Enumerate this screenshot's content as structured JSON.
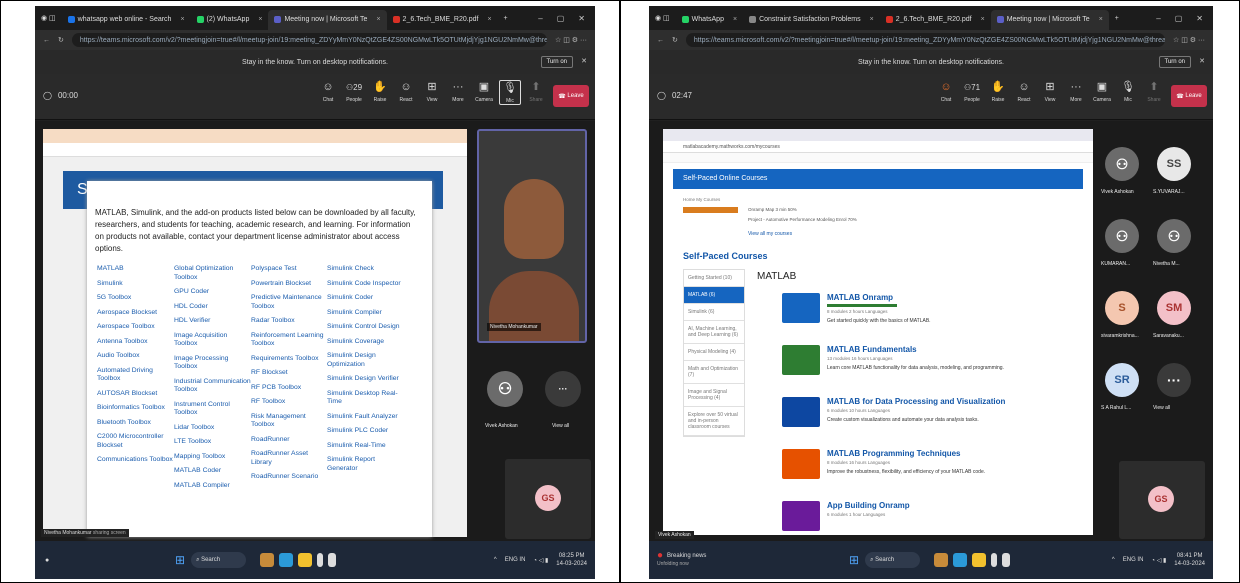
{
  "left": {
    "tabs": [
      {
        "label": "whatsapp web online - Search",
        "color": "#1a73e8"
      },
      {
        "label": "(2) WhatsApp",
        "color": "#25d366"
      },
      {
        "label": "Meeting now | Microsoft Te",
        "color": "#5b5fc7",
        "active": true
      },
      {
        "label": "2_6.Tech_BME_R20.pdf",
        "color": "#d93025"
      }
    ],
    "url": "https://teams.microsoft.com/v2/?meetingjoin=true#/l/meetup-join/19:meeting_ZDYyMmY0NzQtZGE4ZS00NGMwLTk5OTUtMjdjYjg1NGU2NmMw@thread.v2",
    "notification": "Stay in the know. Turn on desktop notifications.",
    "turn_on": "Turn on",
    "timer": "00:00",
    "people_count": "29",
    "tools": [
      {
        "label": "Chat",
        "icon": "chat-icon"
      },
      {
        "label": "People",
        "icon": "people-icon"
      },
      {
        "label": "Raise",
        "icon": "raise-hand-icon"
      },
      {
        "label": "React",
        "icon": "react-icon"
      },
      {
        "label": "View",
        "icon": "view-icon"
      },
      {
        "label": "More",
        "icon": "more-icon"
      },
      {
        "label": "Camera",
        "icon": "camera-icon"
      },
      {
        "label": "Mic",
        "icon": "mic-icon"
      },
      {
        "label": "Share",
        "icon": "share-icon"
      }
    ],
    "leave": "Leave",
    "intro": "MATLAB, Simulink, and the add-on products listed below can be downloaded by all faculty, researchers, and students for teaching, academic research, and learning. For information on products not available, contact your department license administrator about access options.",
    "products": [
      [
        "MATLAB",
        "Simulink",
        "5G Toolbox",
        "Aerospace Blockset",
        "Aerospace Toolbox",
        "Antenna Toolbox",
        "Audio Toolbox",
        "Automated Driving Toolbox",
        "AUTOSAR Blockset",
        "Bioinformatics Toolbox",
        "Bluetooth Toolbox",
        "C2000 Microcontroller Blockset",
        "Communications Toolbox"
      ],
      [
        "Global Optimization Toolbox",
        "GPU Coder",
        "HDL Coder",
        "HDL Verifier",
        "Image Acquisition Toolbox",
        "Image Processing Toolbox",
        "Industrial Communication Toolbox",
        "Instrument Control Toolbox",
        "Lidar Toolbox",
        "LTE Toolbox",
        "Mapping Toolbox",
        "MATLAB Coder",
        "MATLAB Compiler"
      ],
      [
        "Polyspace Test",
        "Powertrain Blockset",
        "Predictive Maintenance Toolbox",
        "Radar Toolbox",
        "Reinforcement Learning Toolbox",
        "Requirements Toolbox",
        "RF Blockset",
        "RF PCB Toolbox",
        "RF Toolbox",
        "Risk Management Toolbox",
        "RoadRunner",
        "RoadRunner Asset Library",
        "RoadRunner Scenario"
      ],
      [
        "Simulink Check",
        "Simulink Code Inspector",
        "Simulink Coder",
        "Simulink Compiler",
        "Simulink Control Design",
        "Simulink Coverage",
        "Simulink Design Optimization",
        "Simulink Design Verifier",
        "Simulink Desktop Real-Time",
        "Simulink Fault Analyzer",
        "Simulink PLC Coder",
        "Simulink Real-Time",
        "Simulink Report Generator"
      ]
    ],
    "page_heading": "Sri M",
    "presenter": "Nivetha Mohankumar",
    "presenter_status": "sharing screen",
    "participants": [
      {
        "name": "Nivetha Mohankumar"
      },
      {
        "name": "Vivek Ashokan"
      },
      {
        "name": "View all"
      },
      {
        "initials": "GS"
      }
    ],
    "taskbar_search": "Search",
    "time": "08:25 PM",
    "date": "14-03-2024",
    "lang": "ENG IN"
  },
  "right": {
    "tabs": [
      {
        "label": "WhatsApp",
        "color": "#25d366"
      },
      {
        "label": "Constraint Satisfaction Problems",
        "color": "#888888"
      },
      {
        "label": "2_6.Tech_BME_R20.pdf",
        "color": "#d93025"
      },
      {
        "label": "Meeting now | Microsoft Te",
        "color": "#5b5fc7",
        "active": true
      }
    ],
    "url": "https://teams.microsoft.com/v2/?meetingjoin=true#/l/meetup-join/19:meeting_ZDYyMmY0NzQtZGE4ZS00NGMwLTk5OTUtMjdjYjg1NGU2NmMw@thread.v2",
    "notification": "Stay in the know. Turn on desktop notifications.",
    "turn_on": "Turn on",
    "timer": "02:47",
    "people_count": "71",
    "leave": "Leave",
    "inner_url": "matlabacademy.mathworks.com/mycourses",
    "page_banner": "Self-Paced Online Courses",
    "breadcrumb": "Home  My Courses",
    "recent": [
      "Onramp Map  3 min  50%",
      "Project - Automotive Performance Modeling  Enrol  70%"
    ],
    "view_all": "View all my courses",
    "section": "Self-Paced Courses",
    "nav": [
      "Getting Started (10)",
      "MATLAB (6)",
      "Simulink (6)",
      "AI, Machine Learning, and Deep Learning (6)",
      "Physical Modeling (4)",
      "Math and Optimization (7)",
      "Image and Signal Processing (4)",
      "Explore over 50 virtual and in-person classroom courses"
    ],
    "category": "MATLAB",
    "courses": [
      {
        "title": "MATLAB Onramp",
        "meta": "8 modules  2 hours  Languages",
        "desc": "Get started quickly with the basics of MATLAB.",
        "color": "#1565c0"
      },
      {
        "title": "MATLAB Fundamentals",
        "meta": "13 modules  16 hours  Languages",
        "desc": "Learn core MATLAB functionality for data analysis, modeling, and programming.",
        "color": "#2e7d32"
      },
      {
        "title": "MATLAB for Data Processing and Visualization",
        "meta": "6 modules  10 hours  Languages",
        "desc": "Create custom visualizations and automate your data analysis tasks.",
        "color": "#0d47a1"
      },
      {
        "title": "MATLAB Programming Techniques",
        "meta": "8 modules  16 hours  Languages",
        "desc": "Improve the robustness, flexibility, and efficiency of your MATLAB code.",
        "color": "#e65100"
      },
      {
        "title": "App Building Onramp",
        "meta": "6 modules  1 hour  Languages",
        "desc": "",
        "color": "#6a1b9a"
      }
    ],
    "participants": [
      {
        "name": "Vivek Ashokan",
        "initials": ""
      },
      {
        "name": "S.YUVARAJ...",
        "initials": "SS"
      },
      {
        "name": "KUMARAN...",
        "initials": ""
      },
      {
        "name": "Nivetha M...",
        "initials": ""
      },
      {
        "name": "sivaramkrishna...",
        "initials": "S"
      },
      {
        "name": "Saravanaku...",
        "initials": "SM"
      },
      {
        "name": "S A Rahul L...",
        "initials": "SR"
      },
      {
        "name": "View all",
        "initials": ""
      },
      {
        "name": "",
        "initials": "GS"
      }
    ],
    "self_label": "Vivek Ashokan",
    "news": "Breaking news",
    "news_sub": "Unfolding now",
    "taskbar_search": "Search",
    "time": "08:41 PM",
    "date": "14-03-2024",
    "lang": "ENG IN"
  }
}
